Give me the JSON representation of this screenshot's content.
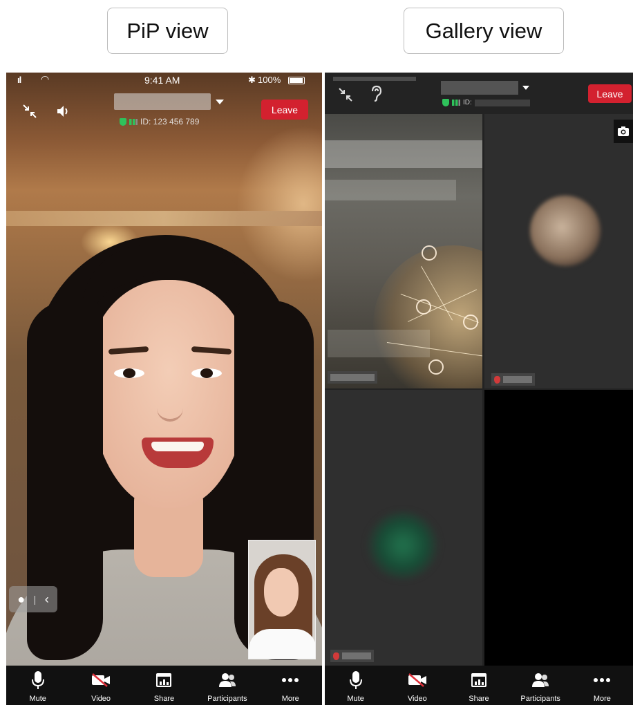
{
  "captions": {
    "pip": "PiP view",
    "gallery": "Gallery view"
  },
  "pip": {
    "status_bar": {
      "time": "9:41 AM",
      "battery": "100%"
    },
    "meeting_id": "ID: 123 456 789",
    "leave_label": "Leave",
    "toolbar": [
      {
        "label": "Mute",
        "icon": "microphone-icon"
      },
      {
        "label": "Video",
        "icon": "video-off-icon"
      },
      {
        "label": "Share",
        "icon": "share-screen-icon"
      },
      {
        "label": "Participants",
        "icon": "participants-icon"
      },
      {
        "label": "More",
        "icon": "more-icon"
      }
    ]
  },
  "gallery": {
    "meeting_id": "ID:",
    "leave_label": "Leave",
    "toolbar": [
      {
        "label": "Mute",
        "icon": "microphone-icon"
      },
      {
        "label": "Video",
        "icon": "video-off-icon"
      },
      {
        "label": "Share",
        "icon": "share-screen-icon"
      },
      {
        "label": "Participants",
        "icon": "participants-icon"
      },
      {
        "label": "More",
        "icon": "more-icon"
      }
    ]
  },
  "colors": {
    "leave_button": "#d3212f",
    "toolbar_bg": "#111111",
    "secure_green": "#2fc25b"
  }
}
